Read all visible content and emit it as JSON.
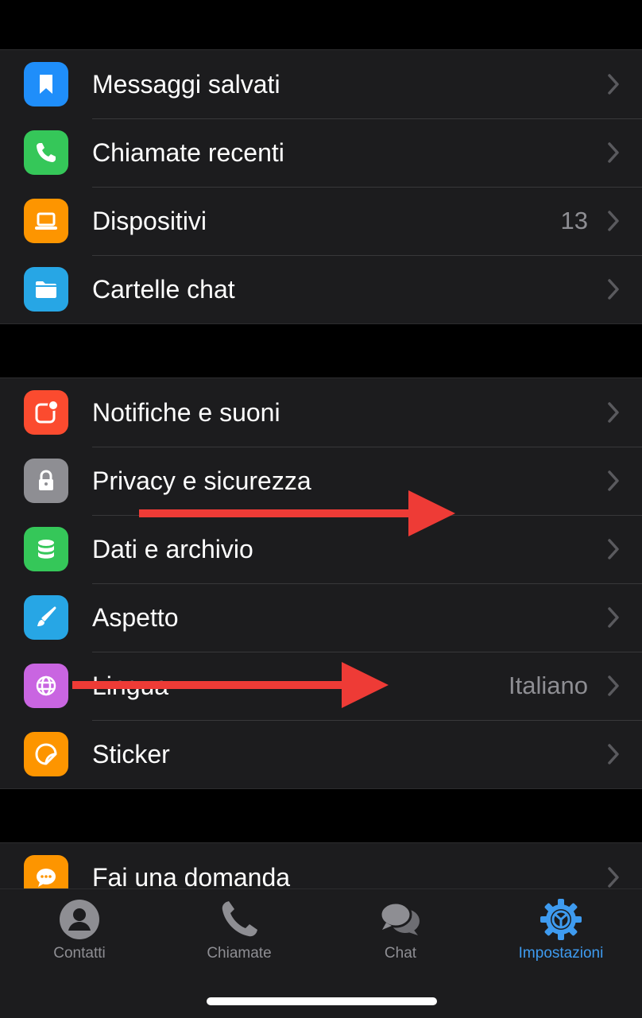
{
  "colors": {
    "background": "#000000",
    "row_background": "#1c1c1e",
    "accent": "#3e9bf0",
    "secondary_text": "#8e8e93",
    "annotation_arrow": "#ee3b36"
  },
  "groups": [
    {
      "items": [
        {
          "label": "Messaggi salvati",
          "icon": "bookmark-icon",
          "icon_color": "#1f8efa"
        },
        {
          "label": "Chiamate recenti",
          "icon": "phone-icon",
          "icon_color": "#35c759"
        },
        {
          "label": "Dispositivi",
          "value": "13",
          "icon": "laptop-icon",
          "icon_color": "#fd9500"
        },
        {
          "label": "Cartelle chat",
          "icon": "folder-icon",
          "icon_color": "#27a6e5"
        }
      ]
    },
    {
      "items": [
        {
          "label": "Notifiche e suoni",
          "icon": "notification-icon",
          "icon_color": "#fb4b2f"
        },
        {
          "label": "Privacy e sicurezza",
          "icon": "lock-icon",
          "icon_color": "#8e8e93"
        },
        {
          "label": "Dati e archivio",
          "icon": "database-icon",
          "icon_color": "#35c759"
        },
        {
          "label": "Aspetto",
          "icon": "brush-icon",
          "icon_color": "#27a6e5"
        },
        {
          "label": "Lingua",
          "value": "Italiano",
          "icon": "globe-icon",
          "icon_color": "#c965e1"
        },
        {
          "label": "Sticker",
          "icon": "sticker-icon",
          "icon_color": "#fd9500"
        }
      ]
    },
    {
      "items": [
        {
          "label": "Fai una domanda",
          "icon": "chat-bubble-icon",
          "icon_color": "#fd9500"
        }
      ]
    }
  ],
  "tabs": [
    {
      "label": "Contatti",
      "icon": "person-icon",
      "active": false
    },
    {
      "label": "Chiamate",
      "icon": "phone-icon",
      "active": false
    },
    {
      "label": "Chat",
      "icon": "chat-bubbles-icon",
      "active": false
    },
    {
      "label": "Impostazioni",
      "icon": "gear-icon",
      "active": true
    }
  ],
  "annotations": [
    "arrow-right",
    "arrow-right"
  ]
}
